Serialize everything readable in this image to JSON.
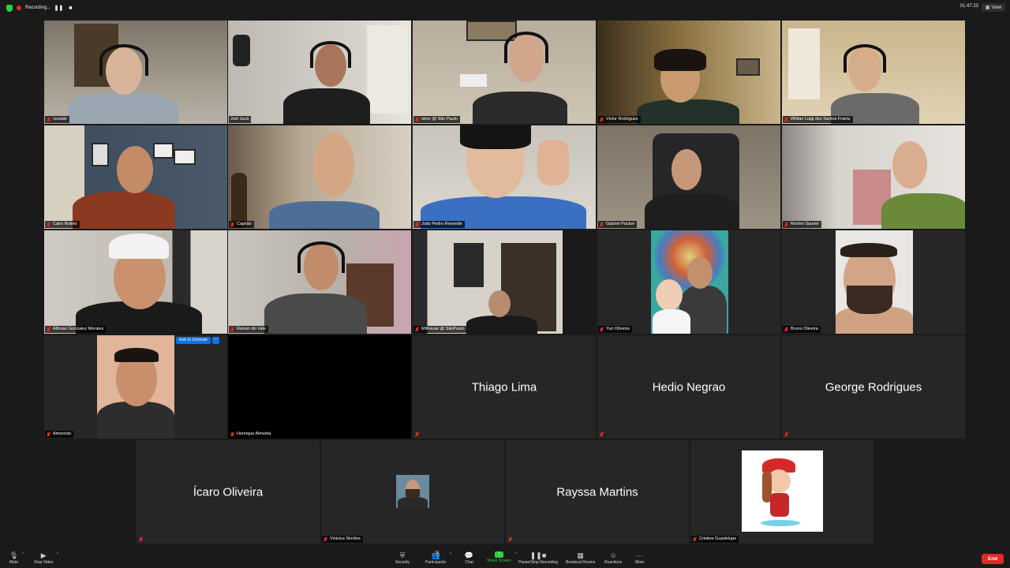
{
  "topbar": {
    "recording_label": "Recording...",
    "pause_symbol": "❚❚",
    "stop_symbol": "■",
    "clock": "01:47:23",
    "view_label": "View"
  },
  "tiles": [
    {
      "name": "cevado",
      "muted": true,
      "bg": "#8e8a82"
    },
    {
      "name": "Joel Jucá",
      "muted": false,
      "bg": "#c9c6bf",
      "active": true
    },
    {
      "name": "nirev @ São Paulo",
      "muted": true,
      "bg": "#a59b8a"
    },
    {
      "name": "Victor Rodrigues",
      "muted": true,
      "bg": "#6b5a3a"
    },
    {
      "name": "Willian Luigi dos Santos Frantz",
      "muted": true,
      "bg": "#b49a70"
    },
    {
      "name": "Cairo Noleto",
      "muted": true,
      "bg": "#4a5a6a"
    },
    {
      "name": "Capitão",
      "muted": true,
      "bg": "#9a8a7a"
    },
    {
      "name": "João Pedro Resende",
      "muted": true,
      "bg": "#b8b2a8"
    },
    {
      "name": "Gabriel Packer",
      "muted": true,
      "bg": "#8d8477"
    },
    {
      "name": "Morôni Sauner",
      "muted": true,
      "bg": "#c7c3bc"
    },
    {
      "name": "Alfonso Gonzalez Morales",
      "muted": true,
      "bg": "#c3bfb8"
    },
    {
      "name": "Reison do Vale",
      "muted": true,
      "bg": "#b7a7a0"
    },
    {
      "name": "Milhouse @ SãoPaulo",
      "muted": true,
      "bg": "#d0ccc6"
    },
    {
      "name": "Yuri Oliveira",
      "muted": true,
      "bg": "#262626"
    },
    {
      "name": "Bruno Oliveira",
      "muted": true,
      "bg": "#262626"
    },
    {
      "name": "Amorésio",
      "muted": true,
      "bg": "#262626",
      "ask_to_unmute": "Ask to Unmute",
      "more": "···"
    },
    {
      "name": "Henrique Almeida",
      "muted": true,
      "bg": "#000000"
    },
    {
      "name": "",
      "display_name": "Thiago Lima",
      "muted": true,
      "bg": "#262626"
    },
    {
      "name": "",
      "display_name": "Hedio Negrao",
      "muted": true,
      "bg": "#262626"
    },
    {
      "name": "",
      "display_name": "George Rodrigues",
      "muted": true,
      "bg": "#262626"
    },
    {
      "name": "",
      "display_name": "Ícaro Oliveira",
      "muted": true,
      "bg": "#262626"
    },
    {
      "name": "Vinicius Simões",
      "muted": true,
      "bg": "#262626"
    },
    {
      "name": "",
      "display_name": "Rayssa Martins",
      "muted": true,
      "bg": "#262626"
    },
    {
      "name": "Cristine Guadelupe",
      "muted": true,
      "bg": "#262626"
    }
  ],
  "toolbar": {
    "mute": "Mute",
    "stop_video": "Stop Video",
    "security": "Security",
    "participants": "Participants",
    "participants_count": "24",
    "chat": "Chat",
    "share_screen": "Share Screen",
    "pause_recording": "Pause/Stop Recording",
    "breakout_rooms": "Breakout Rooms",
    "reactions": "Reactions",
    "more": "More",
    "end": "End"
  },
  "colors": {
    "background": "#1a1a1a",
    "tile": "#262626",
    "active_outline": "#c9d742",
    "muted_red": "#e02828",
    "share_green": "#2ecc40",
    "end_red": "#e02828",
    "unmute_blue": "#0e71eb"
  }
}
